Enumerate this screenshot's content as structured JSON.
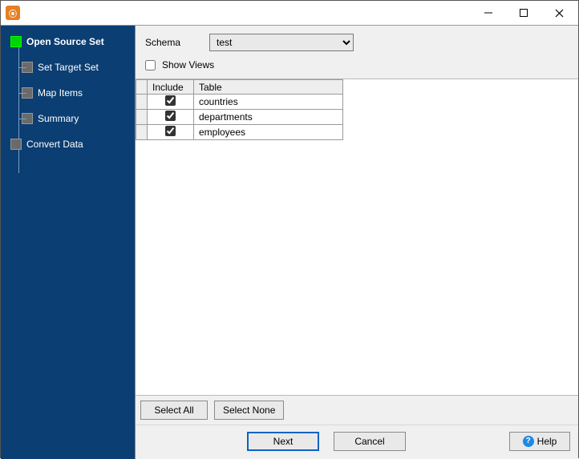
{
  "window": {
    "minimize_icon": "minimize-icon",
    "maximize_icon": "maximize-icon",
    "close_icon": "close-icon"
  },
  "sidebar": {
    "steps": [
      {
        "label": "Open Source Set",
        "active": true,
        "child": false
      },
      {
        "label": "Set Target Set",
        "active": false,
        "child": true
      },
      {
        "label": "Map Items",
        "active": false,
        "child": true
      },
      {
        "label": "Summary",
        "active": false,
        "child": true
      },
      {
        "label": "Convert Data",
        "active": false,
        "child": false
      }
    ]
  },
  "form": {
    "schema_label": "Schema",
    "schema_value": "test",
    "show_views_label": "Show Views",
    "show_views_checked": false
  },
  "grid": {
    "headers": {
      "include": "Include",
      "table": "Table"
    },
    "rows": [
      {
        "include": true,
        "table": "countries"
      },
      {
        "include": true,
        "table": "departments"
      },
      {
        "include": true,
        "table": "employees"
      }
    ]
  },
  "buttons": {
    "select_all": "Select All",
    "select_none": "Select None",
    "next": "Next",
    "cancel": "Cancel",
    "help": "Help"
  }
}
